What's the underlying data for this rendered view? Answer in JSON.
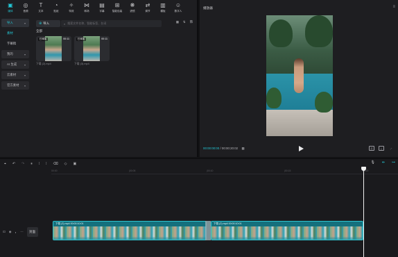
{
  "toolbar": {
    "items": [
      {
        "label": "媒体",
        "icon": "media-icon",
        "active": true
      },
      {
        "label": "音频",
        "icon": "audio-icon"
      },
      {
        "label": "文本",
        "icon": "text-icon"
      },
      {
        "label": "贴纸",
        "icon": "sticker-icon"
      },
      {
        "label": "特效",
        "icon": "effects-icon"
      },
      {
        "label": "转场",
        "icon": "transition-icon"
      },
      {
        "label": "字幕",
        "icon": "caption-icon"
      },
      {
        "label": "智能包装",
        "icon": "smart-pack-icon"
      },
      {
        "label": "滤镜",
        "icon": "filter-icon"
      },
      {
        "label": "调节",
        "icon": "adjust-icon"
      },
      {
        "label": "模板",
        "icon": "template-icon"
      },
      {
        "label": "数字人",
        "icon": "avatar-icon"
      }
    ]
  },
  "side_nav": {
    "items": [
      {
        "label": "导入",
        "has_chevron": true,
        "active": true
      },
      {
        "label": "素材",
        "sub": true
      },
      {
        "label": "字幕稿"
      },
      {
        "label": "我的",
        "has_chevron": true
      },
      {
        "label": "AI 生成",
        "has_chevron": true
      },
      {
        "label": "云素材",
        "has_chevron": true
      },
      {
        "label": "官方素材",
        "has_chevron": true
      }
    ]
  },
  "media": {
    "import_label": "导入",
    "search_placeholder": "搜索文件名称、智能标签、台词",
    "sort_label": "⇅",
    "filter_label": "筛",
    "all_label": "全部",
    "clips": [
      {
        "tag": "已添加",
        "duration": "00:11",
        "name": "下载 (2).mp4"
      },
      {
        "tag": "已添加",
        "duration": "00:11",
        "name": "下载 (3).mp4"
      }
    ]
  },
  "player": {
    "title": "播放器",
    "current_time": "00:00:00:00",
    "total_time": "00:00:20:02"
  },
  "timeline": {
    "ruler_ticks": [
      "00:00",
      "|00:05",
      "|00:10",
      "|00:15",
      "|00:20",
      "|00:25"
    ],
    "cover_label": "封面",
    "clips": [
      {
        "label": "下载 (3).mp4  00:00:10:01"
      },
      {
        "label": "下载 (2).mp4  00:00:10:01"
      }
    ]
  }
}
